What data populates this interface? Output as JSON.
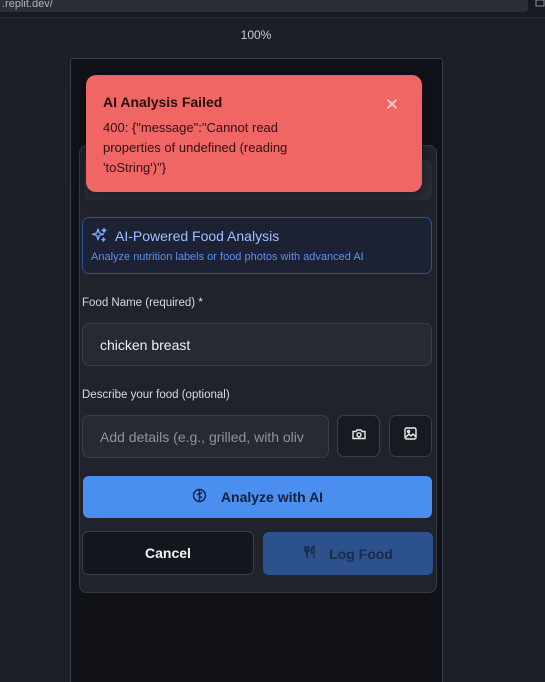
{
  "browser": {
    "url_fragment": ".replit.dev/",
    "zoom": "100%"
  },
  "toast": {
    "title": "AI Analysis Failed",
    "message": "400: {\"message\":\"Cannot read\nproperties of undefined (reading\n'toString')\"}",
    "close_icon": "close-icon",
    "bg_color": "#f06664"
  },
  "ai_panel": {
    "title": "AI-Powered Food Analysis",
    "subtitle": "Analyze nutrition labels or food photos with advanced AI",
    "icon": "sparkle-icon"
  },
  "food_name": {
    "label": "Food Name (required) *",
    "value": "chicken breast"
  },
  "description": {
    "label": "Describe your food (optional)",
    "placeholder": "Add details (e.g., grilled, with oliv"
  },
  "buttons": {
    "camera_icon": "camera-icon",
    "image_icon": "image-icon",
    "analyze": "Analyze with AI",
    "cancel": "Cancel",
    "log_food": "Log Food"
  },
  "colors": {
    "accent": "#4a8ef0",
    "log_button": "#2d518d",
    "ai_border": "#2f4fa4"
  }
}
